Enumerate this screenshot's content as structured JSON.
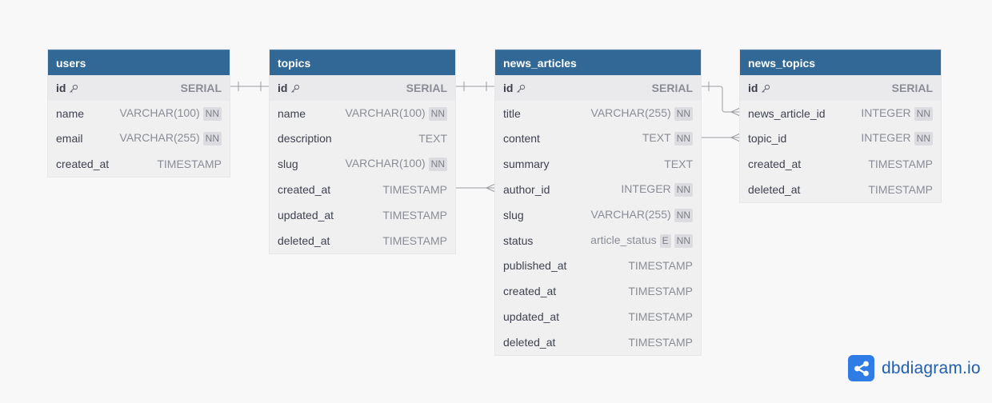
{
  "tables": {
    "users": {
      "title": "users",
      "fields": [
        {
          "name": "id",
          "type": "SERIAL"
        },
        {
          "name": "name",
          "type": "VARCHAR(100)",
          "nn": "NN"
        },
        {
          "name": "email",
          "type": "VARCHAR(255)",
          "nn": "NN"
        },
        {
          "name": "created_at",
          "type": "TIMESTAMP"
        }
      ]
    },
    "topics": {
      "title": "topics",
      "fields": [
        {
          "name": "id",
          "type": "SERIAL"
        },
        {
          "name": "name",
          "type": "VARCHAR(100)",
          "nn": "NN"
        },
        {
          "name": "description",
          "type": "TEXT"
        },
        {
          "name": "slug",
          "type": "VARCHAR(100)",
          "nn": "NN"
        },
        {
          "name": "created_at",
          "type": "TIMESTAMP"
        },
        {
          "name": "updated_at",
          "type": "TIMESTAMP"
        },
        {
          "name": "deleted_at",
          "type": "TIMESTAMP"
        }
      ]
    },
    "news_articles": {
      "title": "news_articles",
      "fields": [
        {
          "name": "id",
          "type": "SERIAL"
        },
        {
          "name": "title",
          "type": "VARCHAR(255)",
          "nn": "NN"
        },
        {
          "name": "content",
          "type": "TEXT",
          "nn": "NN"
        },
        {
          "name": "summary",
          "type": "TEXT"
        },
        {
          "name": "author_id",
          "type": "INTEGER",
          "nn": "NN"
        },
        {
          "name": "slug",
          "type": "VARCHAR(255)",
          "nn": "NN"
        },
        {
          "name": "status",
          "type": "article_status",
          "enum": "E",
          "nn": "NN"
        },
        {
          "name": "published_at",
          "type": "TIMESTAMP"
        },
        {
          "name": "created_at",
          "type": "TIMESTAMP"
        },
        {
          "name": "updated_at",
          "type": "TIMESTAMP"
        },
        {
          "name": "deleted_at",
          "type": "TIMESTAMP"
        }
      ]
    },
    "news_topics": {
      "title": "news_topics",
      "fields": [
        {
          "name": "id",
          "type": "SERIAL"
        },
        {
          "name": "news_article_id",
          "type": "INTEGER",
          "nn": "NN"
        },
        {
          "name": "topic_id",
          "type": "INTEGER",
          "nn": "NN"
        },
        {
          "name": "created_at",
          "type": "TIMESTAMP"
        },
        {
          "name": "deleted_at",
          "type": "TIMESTAMP"
        }
      ]
    }
  },
  "logo": {
    "text": "dbdiagram.io"
  },
  "colors": {
    "header": "#316896",
    "body": "#f0f0f1",
    "connector": "#9a9ca3",
    "logo": "#2f7ce6"
  }
}
